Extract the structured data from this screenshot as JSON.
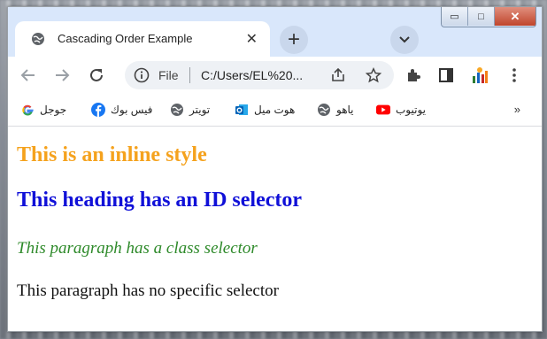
{
  "window": {
    "controls": {
      "minimize": "▭",
      "maximize": "□",
      "close": "✕"
    }
  },
  "tab": {
    "title": "Cascading Order Example",
    "close": "✕"
  },
  "newtab": {
    "label": "+"
  },
  "toolbar": {
    "omnibox": {
      "scheme_label": "File",
      "url": "C:/Users/EL%20..."
    },
    "icons": [
      "back-icon",
      "forward-icon",
      "reload-icon",
      "info-icon",
      "share-icon",
      "star-icon",
      "extensions-icon",
      "sidepanel-icon",
      "profile-icon",
      "menu-icon"
    ]
  },
  "bookmarks": {
    "items": [
      {
        "label": "جوجل",
        "icon": "google-icon"
      },
      {
        "label": "فيس بوك",
        "icon": "facebook-icon"
      },
      {
        "label": "تويتر",
        "icon": "globe-icon"
      },
      {
        "label": "هوت ميل",
        "icon": "outlook-icon"
      },
      {
        "label": "ياهو",
        "icon": "globe-icon"
      },
      {
        "label": "يوتيوب",
        "icon": "youtube-icon"
      }
    ],
    "more": "»"
  },
  "page": {
    "inline_heading": "This is an inline style",
    "id_heading": "This heading has an ID selector",
    "class_paragraph": "This paragraph has a class selector",
    "plain_paragraph": "This paragraph has no specific selector"
  },
  "colors": {
    "inline_heading": "#f5a21d",
    "id_heading": "#1010d8",
    "class_paragraph": "#2e8a2a",
    "tabstrip": "#d9e7fb"
  }
}
